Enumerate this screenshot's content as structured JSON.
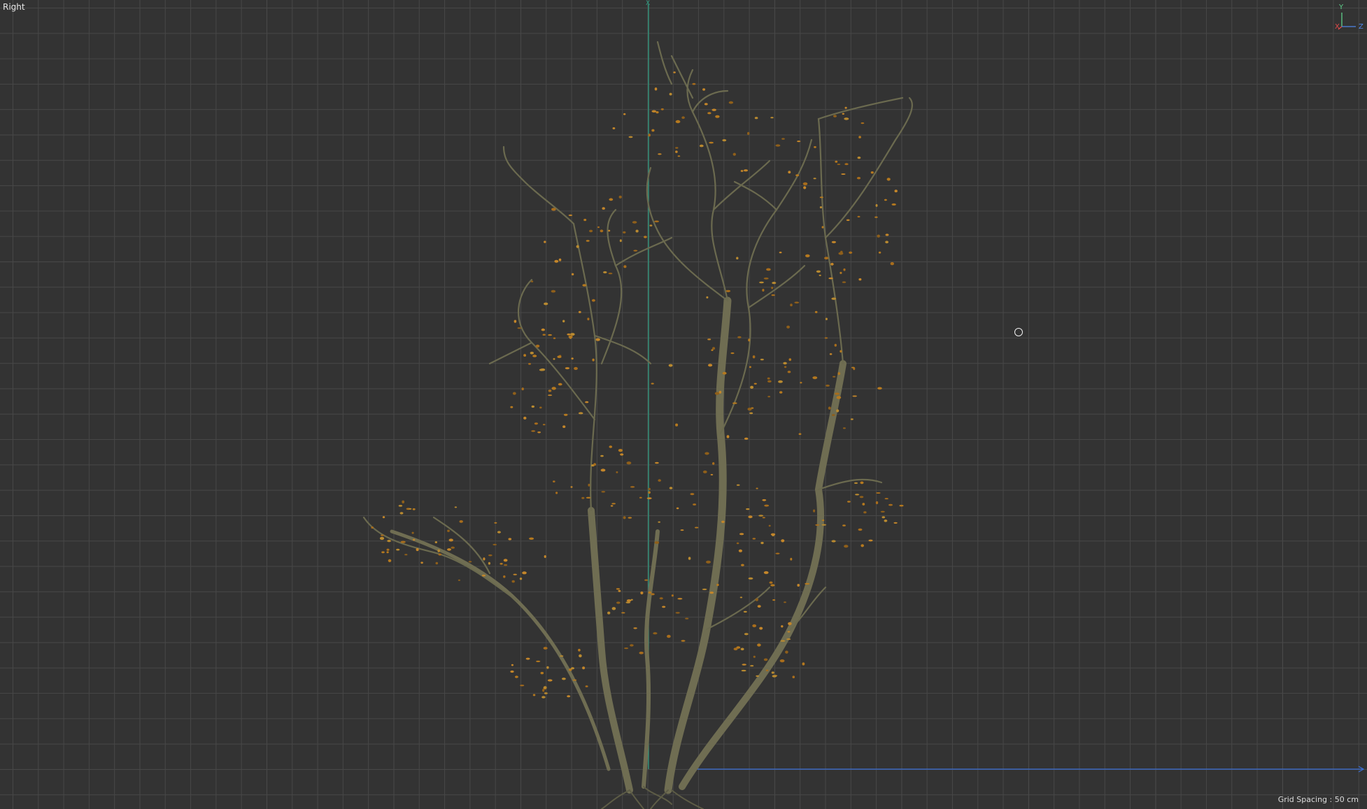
{
  "viewport": {
    "view_name": "Right",
    "grid_spacing_label": "Grid Spacing : 50 cm"
  },
  "gizmo": {
    "y_label": "Y",
    "x_label": "X",
    "z_label": "Z"
  },
  "axis_origin_label": "X",
  "colors": {
    "background": "#333333",
    "grid_minor": "#474747",
    "grid_major": "#545454",
    "vertical_axis": "#2fa387",
    "horizontal_axis": "#3b6fd6",
    "gizmo_x": "#e24a4a",
    "gizmo_y": "#5fd08a",
    "gizmo_z": "#4f86e8",
    "bark": "#6b6a4f",
    "leaf": "#b5791f"
  },
  "icons": {
    "orbit_cursor": "orbit-target-icon",
    "axis_gizmo": "axis-gizmo-icon"
  }
}
